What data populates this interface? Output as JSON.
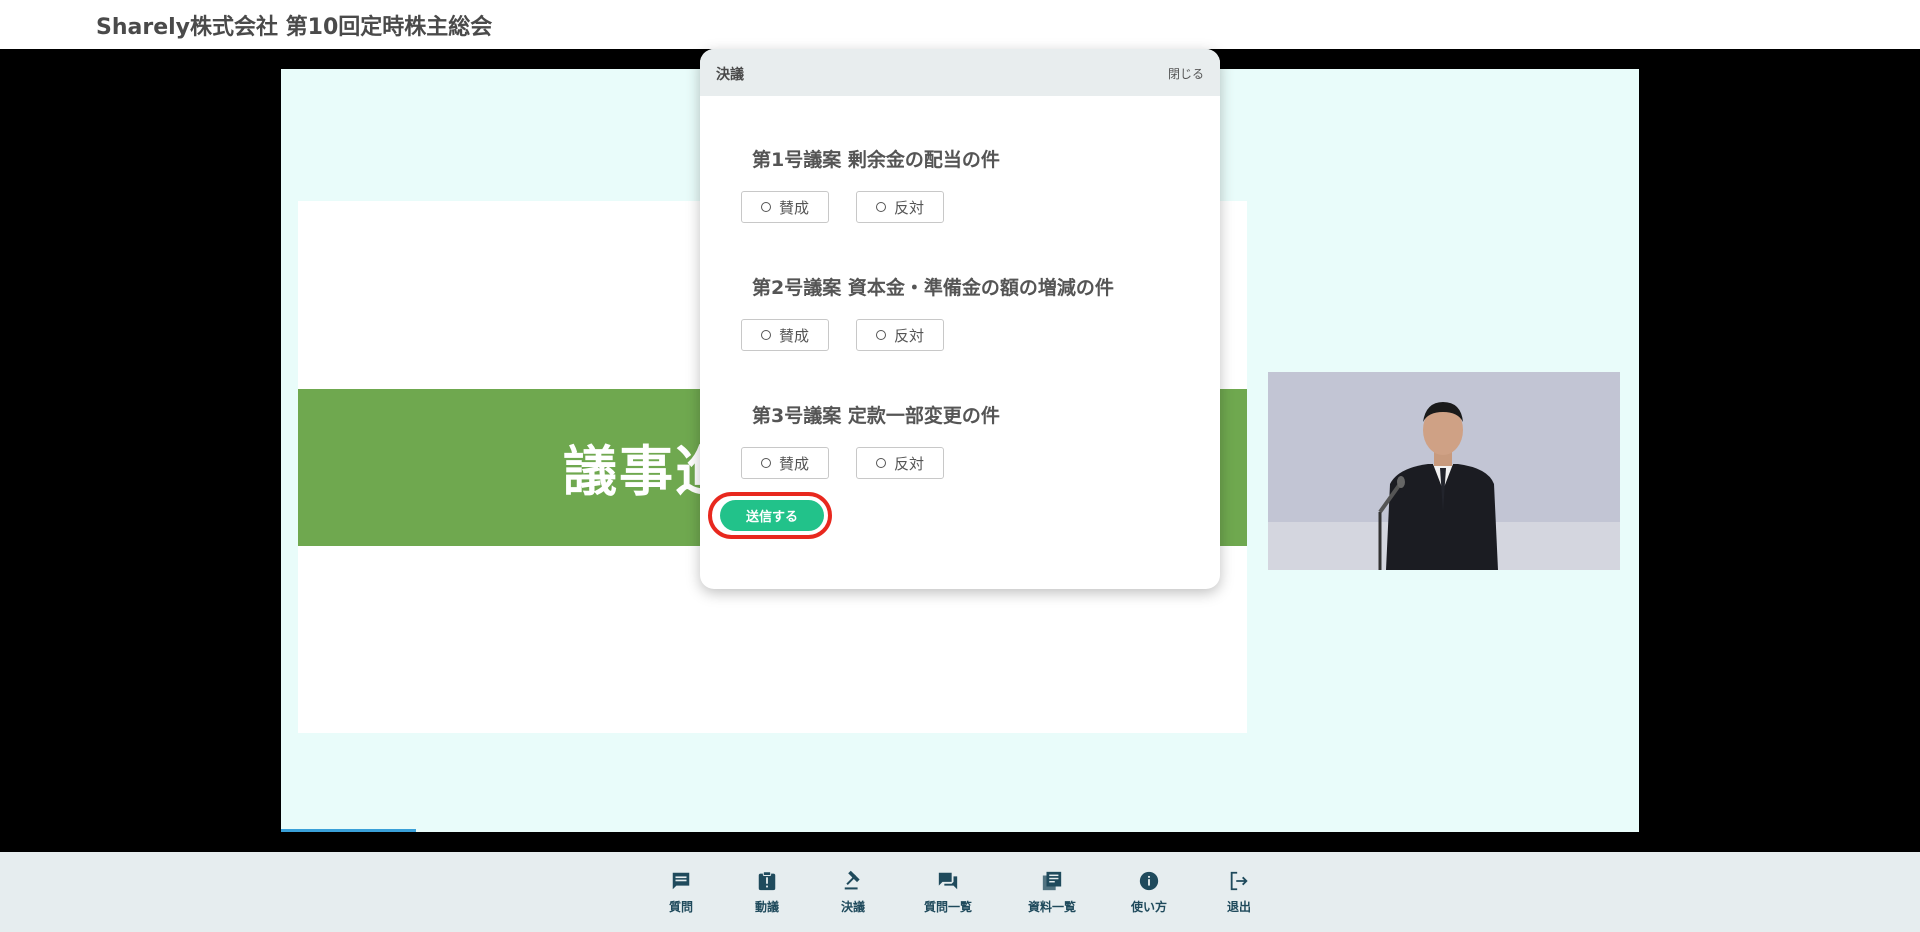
{
  "header": {
    "title": "Sharely株式会社 第10回定時株主総会"
  },
  "slide": {
    "heading": "議事進"
  },
  "modal": {
    "title": "決議",
    "close_label": "閉じる",
    "proposals": [
      {
        "title": "第1号議案  剰余金の配当の件",
        "for_label": "賛成",
        "against_label": "反対"
      },
      {
        "title": "第2号議案  資本金・準備金の額の増減の件",
        "for_label": "賛成",
        "against_label": "反対"
      },
      {
        "title": "第3号議案  定款一部変更の件",
        "for_label": "賛成",
        "against_label": "反対"
      }
    ],
    "submit_label": "送信する"
  },
  "toolbar": {
    "items": [
      {
        "label": "質問",
        "icon": "comment-icon"
      },
      {
        "label": "動議",
        "icon": "motion-clipboard-icon"
      },
      {
        "label": "決議",
        "icon": "gavel-icon"
      },
      {
        "label": "質問一覧",
        "icon": "forum-icon"
      },
      {
        "label": "資料一覧",
        "icon": "documents-icon"
      },
      {
        "label": "使い方",
        "icon": "info-icon"
      },
      {
        "label": "退出",
        "icon": "logout-icon"
      }
    ]
  },
  "colors": {
    "accent_green": "#22c28a",
    "slide_band": "#6fa84f",
    "highlight_red": "#e8281e",
    "toolbar_bg": "#e6edef",
    "toolbar_fg": "#1f4a5c"
  }
}
